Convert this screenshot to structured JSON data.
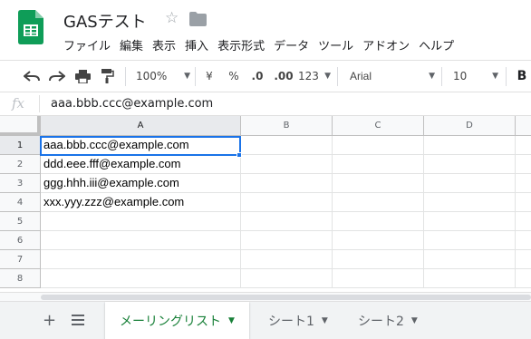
{
  "app": {
    "title": "GASテスト",
    "accent": "#0f9d58"
  },
  "menu": [
    "ファイル",
    "編集",
    "表示",
    "挿入",
    "表示形式",
    "データ",
    "ツール",
    "アドオン",
    "ヘルプ"
  ],
  "toolbar": {
    "zoom": "100%",
    "currency": "¥",
    "percent": "%",
    "decrease_decimal": ".0",
    "increase_decimal": ".00",
    "more_formats": "123",
    "font": "Arial",
    "font_size": "10",
    "bold": "B"
  },
  "formula_bar": {
    "icon": "fx",
    "value": "aaa.bbb.ccc@example.com"
  },
  "grid": {
    "columns": [
      "A",
      "B",
      "C",
      "D"
    ],
    "rows": [
      "1",
      "2",
      "3",
      "4",
      "5",
      "6",
      "7",
      "8"
    ],
    "values_col_a": [
      "aaa.bbb.ccc@example.com",
      "ddd.eee.fff@example.com",
      "ggg.hhh.iii@example.com",
      "xxx.yyy.zzz@example.com",
      "",
      "",
      "",
      ""
    ],
    "selected_cell": "A1",
    "selection_color": "#1a73e8"
  },
  "sheets": {
    "tabs": [
      {
        "label": "メーリングリスト",
        "active": true
      },
      {
        "label": "シート1",
        "active": false
      },
      {
        "label": "シート2",
        "active": false
      }
    ],
    "active_color": "#188038"
  }
}
